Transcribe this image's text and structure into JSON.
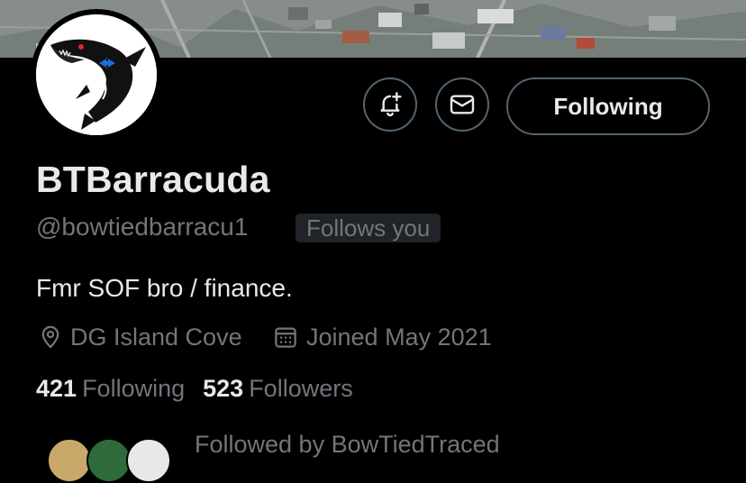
{
  "profile": {
    "display_name": "BTBarracuda",
    "handle": "@bowtiedbarracu1",
    "follows_you_label": "Follows you",
    "bio": "Fmr SOF bro / finance.",
    "location": "DG Island Cove",
    "joined": "Joined May 2021"
  },
  "actions": {
    "following_label": "Following",
    "notify_icon": "bell-plus-icon",
    "message_icon": "mail-icon"
  },
  "stats": {
    "following_count": "421",
    "following_label": "Following",
    "followers_count": "523",
    "followers_label": "Followers"
  },
  "followed_by": {
    "text": "Followed by BowTiedTraced"
  },
  "colors": {
    "background": "#000000",
    "primary_text": "#e7e9ea",
    "secondary_text": "#71767b",
    "border": "#536471",
    "badge_bg": "#202327"
  }
}
